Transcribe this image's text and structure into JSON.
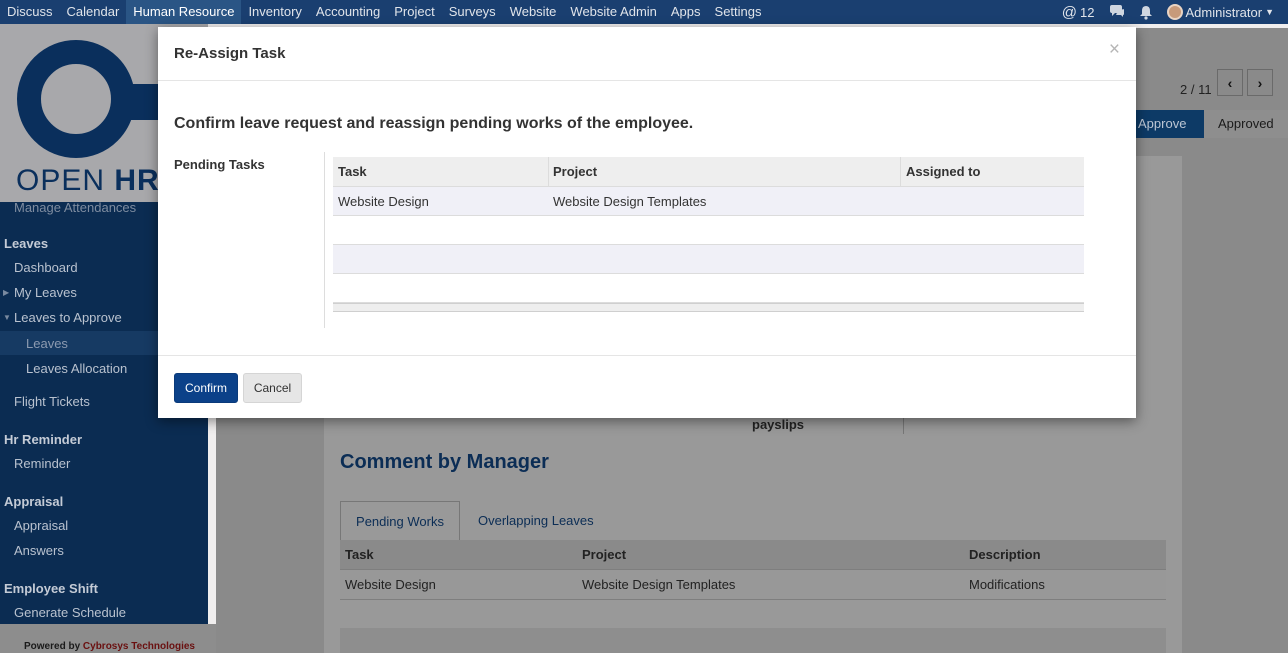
{
  "topbar": {
    "menu": [
      "Discuss",
      "Calendar",
      "Human Resource",
      "Inventory",
      "Accounting",
      "Project",
      "Surveys",
      "Website",
      "Website Admin",
      "Apps",
      "Settings"
    ],
    "active_index": 2,
    "mentions_count": "12",
    "user_name": "Administrator"
  },
  "sidebar": {
    "logo_open": "OPEN",
    "logo_hrm": "HRM",
    "partial_item": "Manage Attendances",
    "leaves_section": "Leaves",
    "leaves_items": [
      "Dashboard",
      "My Leaves",
      "Leaves to Approve"
    ],
    "leaves_sub_items": [
      "Leaves",
      "Leaves Allocation"
    ],
    "flight_tickets": "Flight Tickets",
    "hr_reminder_section": "Hr Reminder",
    "reminder": "Reminder",
    "appraisal_section": "Appraisal",
    "appraisal_items": [
      "Appraisal",
      "Answers"
    ],
    "employee_shift_section": "Employee Shift",
    "generate_schedule": "Generate Schedule",
    "powered_prefix": "Powered by ",
    "powered_company": "Cybrosys Technologies"
  },
  "background": {
    "pager": "2 / 11",
    "status_approve": "Approve",
    "status_approved": "Approved",
    "payslips": "payslips",
    "comment_heading": "Comment by Manager",
    "tabs": [
      "Pending Works",
      "Overlapping Leaves"
    ],
    "table_headers": [
      "Task",
      "Project",
      "Description"
    ],
    "table_rows": [
      [
        "Website Design",
        "Website Design Templates",
        "Modifications"
      ]
    ]
  },
  "modal": {
    "title": "Re-Assign Task",
    "close_symbol": "×",
    "heading": "Confirm leave request and reassign pending works of the employee.",
    "field_label": "Pending Tasks",
    "table_headers": [
      "Task",
      "Project",
      "Assigned to"
    ],
    "table_rows": [
      [
        "Website Design",
        "Website Design Templates",
        ""
      ]
    ],
    "confirm_label": "Confirm",
    "cancel_label": "Cancel"
  },
  "colors": {
    "navbar": "#1a3f70",
    "primary_button": "#0b4189",
    "heading_blue": "#0b2d55"
  }
}
